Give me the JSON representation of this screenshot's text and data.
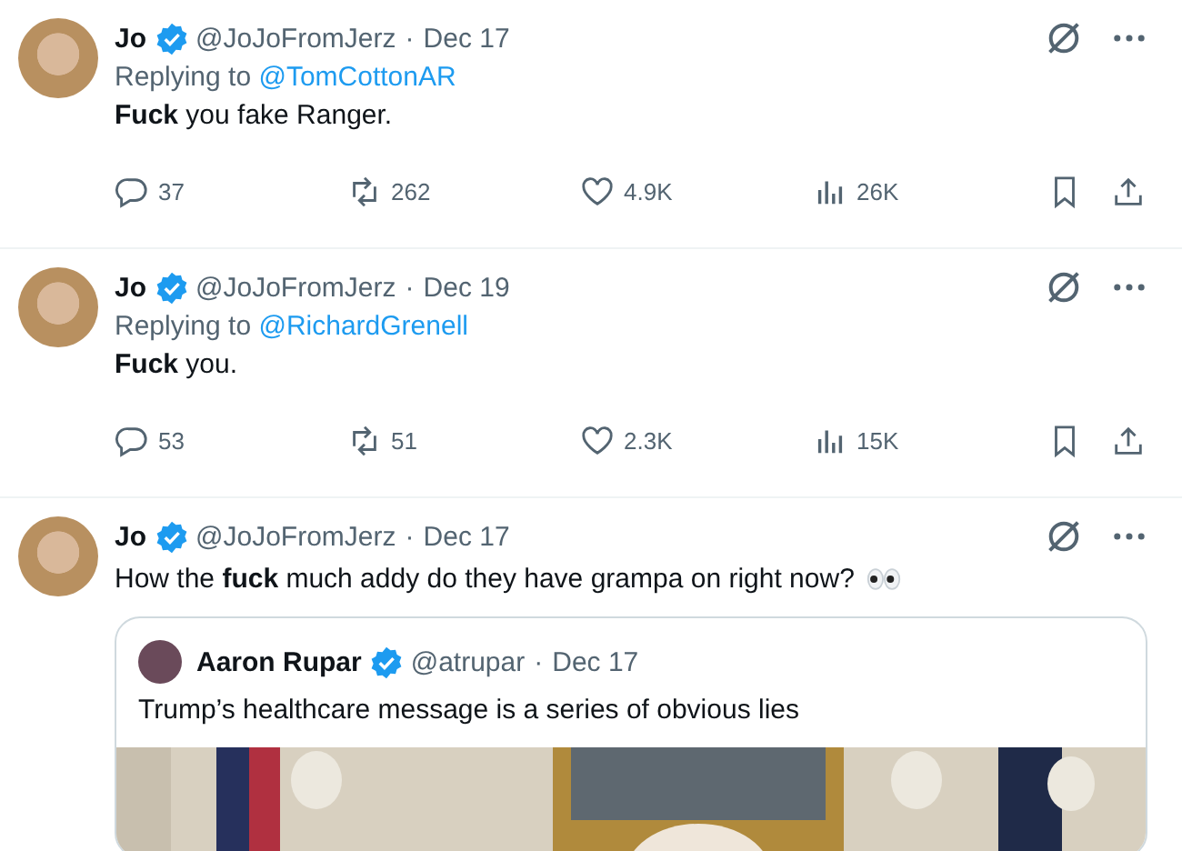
{
  "tweets": [
    {
      "name": "Jo",
      "verified": true,
      "handle": "@JoJoFromJerz",
      "sep": "·",
      "date": "Dec 17",
      "reply_prefix": "Replying to",
      "reply_handle": "@TomCottonAR",
      "text": "**Fuck** you fake Ranger.",
      "actions": {
        "replies": "37",
        "reposts": "262",
        "likes": "4.9K",
        "views": "26K"
      }
    },
    {
      "name": "Jo",
      "verified": true,
      "handle": "@JoJoFromJerz",
      "sep": "·",
      "date": "Dec 19",
      "reply_prefix": "Replying to",
      "reply_handle": "@RichardGrenell",
      "text": "**Fuck** you.",
      "actions": {
        "replies": "53",
        "reposts": "51",
        "likes": "2.3K",
        "views": "15K"
      }
    },
    {
      "name": "Jo",
      "verified": true,
      "handle": "@JoJoFromJerz",
      "sep": "·",
      "date": "Dec 17",
      "text": "How the **fuck** much addy do they have grampa on right now?",
      "eyes_emoji": true,
      "quote": {
        "name": "Aaron Rupar",
        "verified": true,
        "handle": "@atrupar",
        "sep": "·",
        "date": "Dec 17",
        "text": "Trump’s healthcare message is a series of obvious lies"
      }
    }
  ]
}
